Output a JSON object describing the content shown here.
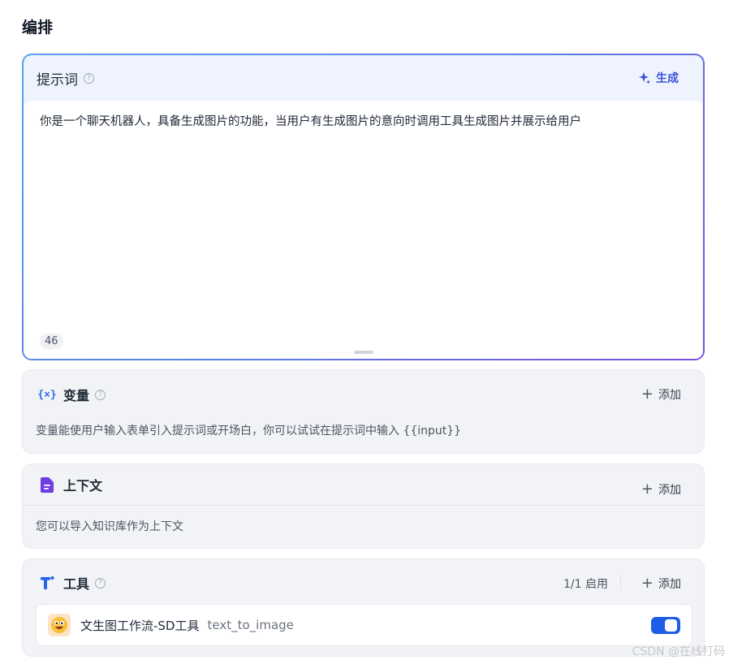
{
  "page": {
    "title": "编排"
  },
  "prompt": {
    "title": "提示词",
    "help": "?",
    "generate_label": "生成",
    "text": "你是一个聊天机器人，具备生成图片的功能，当用户有生成图片的意向时调用工具生成图片并展示给用户",
    "char_count": "46"
  },
  "variables": {
    "icon_text": "{×}",
    "title": "变量",
    "help": "?",
    "add_label": "添加",
    "description": "变量能使用户输入表单引入提示词或开场白，你可以试试在提示词中输入 {{input}}"
  },
  "context": {
    "title": "上下文",
    "add_label": "添加",
    "description": "您可以导入知识库作为上下文"
  },
  "tools": {
    "title": "工具",
    "help": "?",
    "status": "1/1 启用",
    "add_label": "添加",
    "items": [
      {
        "name": "文生图工作流-SD工具",
        "id": "text_to_image",
        "enabled": true,
        "icon": "emoji-face-icon"
      }
    ]
  },
  "watermark": "CSDN @在线打码",
  "colors": {
    "accent": "#3b52d9",
    "toggle_on": "#1d5de8",
    "variable_icon": "#2f6bf0",
    "context_icon": "#6d3fe0",
    "tool_icon": "#2563eb"
  }
}
